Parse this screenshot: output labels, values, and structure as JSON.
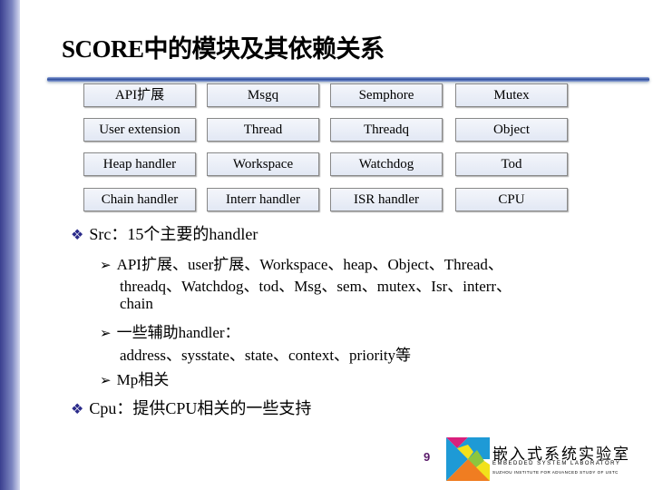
{
  "title": "SCORE中的模块及其依赖关系",
  "modules": [
    [
      "API扩展",
      "Msgq",
      "Semphore",
      "Mutex"
    ],
    [
      "User extension",
      "Thread",
      "Threadq",
      "Object"
    ],
    [
      "Heap handler",
      "Workspace",
      "Watchdog",
      "Tod"
    ],
    [
      "Chain handler",
      "Interr handler",
      "ISR handler",
      "CPU"
    ]
  ],
  "bullets": {
    "src": "Src：15个主要的handler",
    "sub1a": "API扩展、user扩展、Workspace、heap、Object、Thread、",
    "sub1b": "threadq、Watchdog、tod、Msg、sem、mutex、Isr、interr、",
    "sub1c": "chain",
    "sub2a": "一些辅助handler：",
    "sub2b": "address、sysstate、state、context、priority等",
    "sub3": "Mp相关",
    "cpu": "Cpu：提供CPU相关的一些支持"
  },
  "page_number": "9",
  "logo": {
    "cn": "嵌入式系统实验室",
    "en": "EMBEDDED SYSTEM LABORATORY",
    "en2": "SUZHOU INSTITUTE FOR ADVANCED STUDY OF USTC"
  },
  "colors": {
    "sidebar": "#3a3f8f",
    "rule": "#2d4c9c",
    "page": "#5a1a6a"
  }
}
